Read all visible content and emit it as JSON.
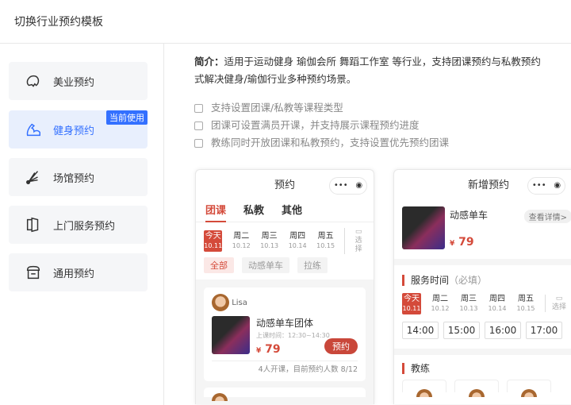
{
  "title": "切换行业预约模板",
  "sidebar": {
    "items": [
      {
        "label": "美业预约",
        "icon": "beauty-icon"
      },
      {
        "label": "健身预约",
        "icon": "muscle-icon",
        "badge": "当前使用"
      },
      {
        "label": "场馆预约",
        "icon": "shuttlecock-icon"
      },
      {
        "label": "上门服务预约",
        "icon": "door-icon"
      },
      {
        "label": "通用预约",
        "icon": "store-icon"
      }
    ]
  },
  "intro": {
    "label": "简介：",
    "text": "适用于运动健身 瑜伽会所 舞蹈工作室 等行业，支持团课预约与私教预约",
    "text2": "式解决健身/瑜伽行业多种预约场景。"
  },
  "features": [
    "支持设置团课/私教等课程类型",
    "团课可设置满员开课，并支持展示课程预约进度",
    "教练同时开放团课和私教预约，支持设置优先预约团课"
  ],
  "phone1": {
    "title": "预约",
    "tabs": [
      "团课",
      "私教",
      "其他"
    ],
    "days": [
      {
        "d": "今天",
        "n": "10.11"
      },
      {
        "d": "周二",
        "n": "10.12"
      },
      {
        "d": "周三",
        "n": "10.13"
      },
      {
        "d": "周四",
        "n": "10.14"
      },
      {
        "d": "周五",
        "n": "10.15"
      }
    ],
    "pick": "选择",
    "chips": [
      "全部",
      "动感单车",
      "拉练"
    ],
    "card": {
      "coach": "Lisa",
      "name": "动感单车团体",
      "time": "上课时间：12:30~14:30",
      "currency": "¥",
      "price": "79",
      "book": "预约",
      "footer": "4人开课，目前预约人数 8/12"
    }
  },
  "phone2": {
    "title": "新增预约",
    "product": "动感单车",
    "detail": "查看详情>",
    "currency": "¥",
    "price": "79",
    "service_time": "服务时间",
    "required": "（必填）",
    "times": [
      "14:00",
      "15:00",
      "16:00",
      "17:00"
    ],
    "coach_label": "教练"
  }
}
